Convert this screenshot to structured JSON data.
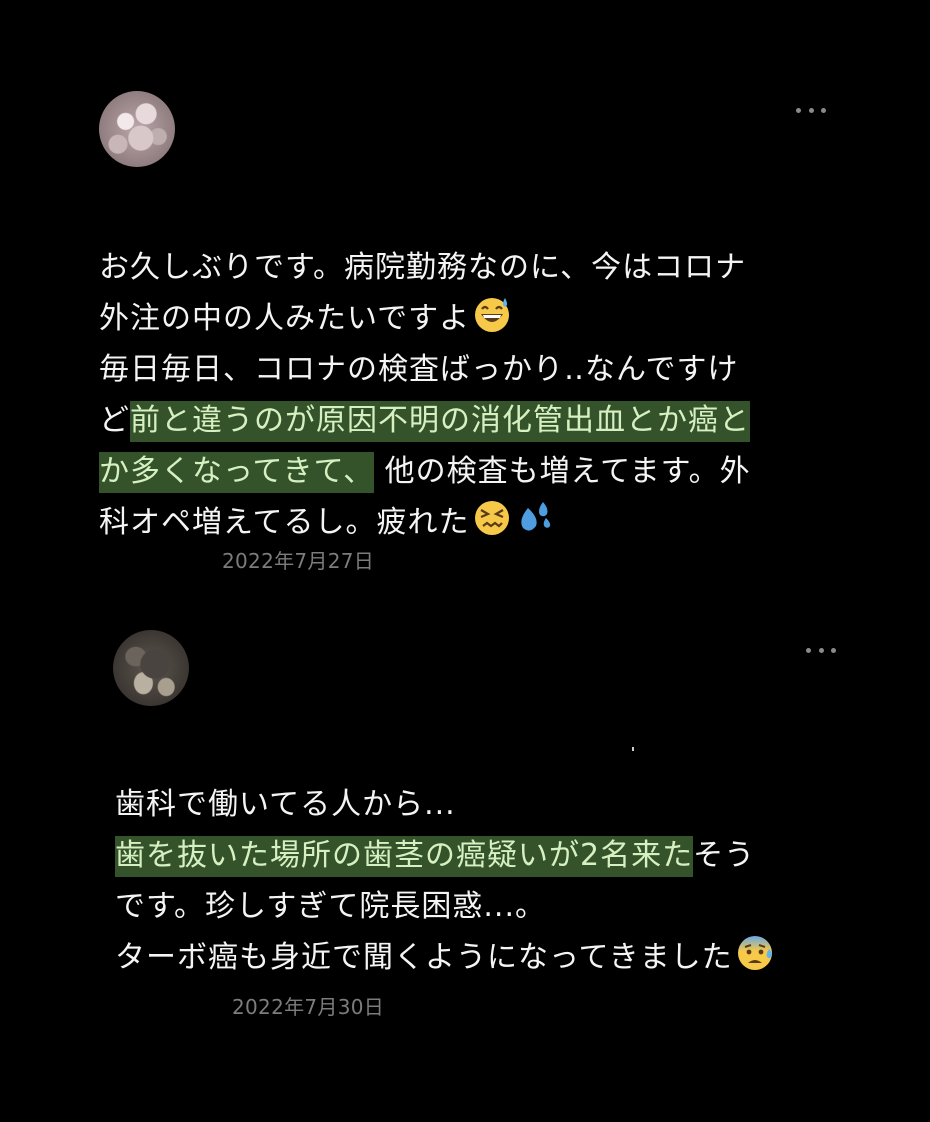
{
  "posts": [
    {
      "lines": [
        {
          "plain": "お久しぶりです。病院勤務なのに、今はコロナ",
          "hl": "",
          "after": ""
        },
        {
          "plain": "外注の中の人みたいですよ",
          "hl": "",
          "after": ""
        },
        {
          "plain": "毎日毎日、コロナの検査ばっかり‥なんですけ",
          "hl": "",
          "after": ""
        },
        {
          "plain": "ど",
          "hl": "前と違うのが原因不明の消化管出血とか癌と",
          "after": ""
        },
        {
          "plain": "",
          "hl": "か多くなってきて、",
          "after": "他の検査も増えてます。外"
        },
        {
          "plain": "科オペ増えてるし。疲れた",
          "hl": "",
          "after": ""
        }
      ],
      "emojis": [
        "grinning-sweat-emoji",
        "confounded-face-emoji",
        "sweat-droplets-emoji"
      ],
      "date": "2022年7月27日"
    },
    {
      "lines": [
        {
          "plain": "歯科で働いてる人から...",
          "hl": "",
          "after": ""
        },
        {
          "plain": "",
          "hl": "歯を抜いた場所の歯茎の癌疑いが2名来た",
          "after": "そう"
        },
        {
          "plain": "です。珍しすぎて院長困惑...。",
          "hl": "",
          "after": ""
        },
        {
          "plain": "ターボ癌も身近で聞くようになってきました",
          "hl": "",
          "after": ""
        }
      ],
      "emojis": [
        "anxious-sweat-face-emoji"
      ],
      "date": "2022年7月30日"
    }
  ],
  "colors": {
    "background": "#000000",
    "text": "#f4f4f4",
    "highlight_bg": "#35532a",
    "highlight_text": "#d6f0c2",
    "date": "#7c7c7c",
    "more_icon": "#8a8a8a"
  }
}
